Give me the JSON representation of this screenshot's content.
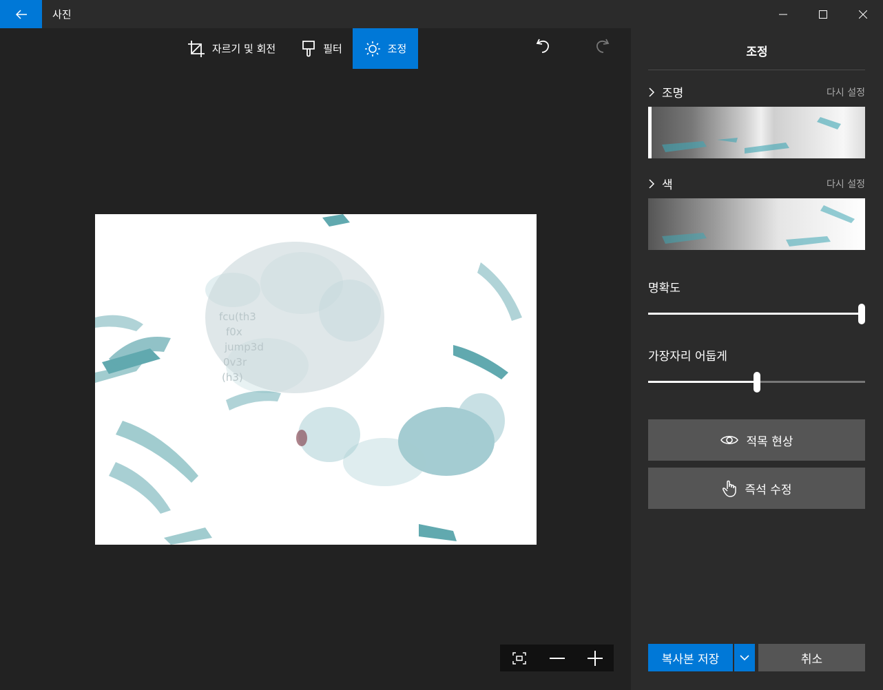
{
  "app": {
    "title": "사진"
  },
  "toolbar": {
    "crop_label": "자르기 및 회전",
    "filter_label": "필터",
    "adjust_label": "조정"
  },
  "panel": {
    "title": "조정",
    "lighting": {
      "label": "조명",
      "reset": "다시 설정",
      "value": 0.0
    },
    "color": {
      "label": "색",
      "reset": "다시 설정"
    },
    "clarity": {
      "label": "명확도",
      "value": 1.0
    },
    "vignette": {
      "label": "가장자리 어둡게",
      "value": 0.5
    },
    "redeye_label": "적목 현상",
    "spotfix_label": "즉석 수정",
    "save_label": "복사본 저장",
    "cancel_label": "취소"
  },
  "photo": {
    "overlay_lines": [
      "fcu(th3",
      "f0x",
      "jump3d",
      "0v3r",
      "(h3)"
    ]
  },
  "colors": {
    "accent": "#0078d7",
    "panel_bg": "#2b2b2b",
    "canvas_bg": "#222222",
    "button_bg": "#555555"
  }
}
